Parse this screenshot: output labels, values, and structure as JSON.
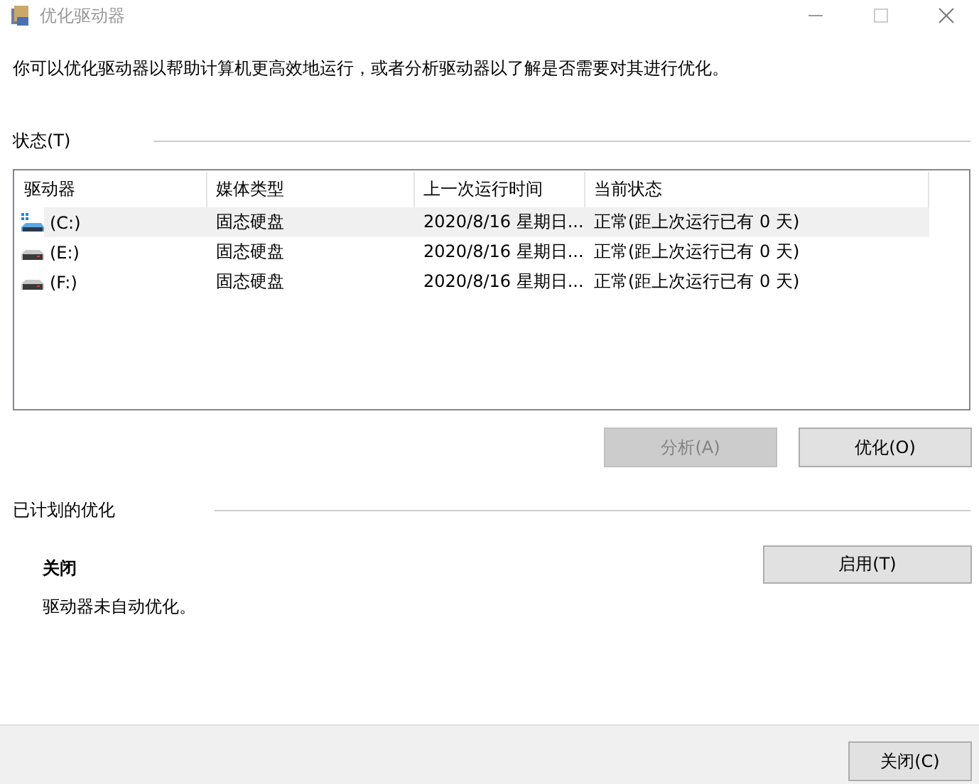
{
  "window": {
    "title": "优化驱动器"
  },
  "description": "你可以优化驱动器以帮助计算机更高效地运行，或者分析驱动器以了解是否需要对其进行优化。",
  "status": {
    "label": "状态(T)",
    "table": {
      "columns": [
        "驱动器",
        "媒体类型",
        "上一次运行时间",
        "当前状态"
      ],
      "rows": [
        {
          "drive": "(C:)",
          "kind": "system",
          "media": "固态硬盘",
          "last_run": "2020/8/16 星期日...",
          "state": "正常(距上次运行已有 0 天)",
          "selected": true
        },
        {
          "drive": "(E:)",
          "kind": "data",
          "media": "固态硬盘",
          "last_run": "2020/8/16 星期日...",
          "state": "正常(距上次运行已有 0 天)",
          "selected": false
        },
        {
          "drive": "(F:)",
          "kind": "data",
          "media": "固态硬盘",
          "last_run": "2020/8/16 星期日...",
          "state": "正常(距上次运行已有 0 天)",
          "selected": false
        }
      ]
    },
    "buttons": [
      {
        "label": "分析(A)",
        "disabled": true
      },
      {
        "label": "优化(O)",
        "disabled": false
      }
    ]
  },
  "scheduled": {
    "label": "已计划的优化",
    "state": "关闭",
    "note": "驱动器未自动优化。",
    "button": {
      "label": "启用(T)",
      "disabled": false
    }
  },
  "footer": {
    "button": {
      "label": "关闭(C)",
      "disabled": false
    }
  }
}
